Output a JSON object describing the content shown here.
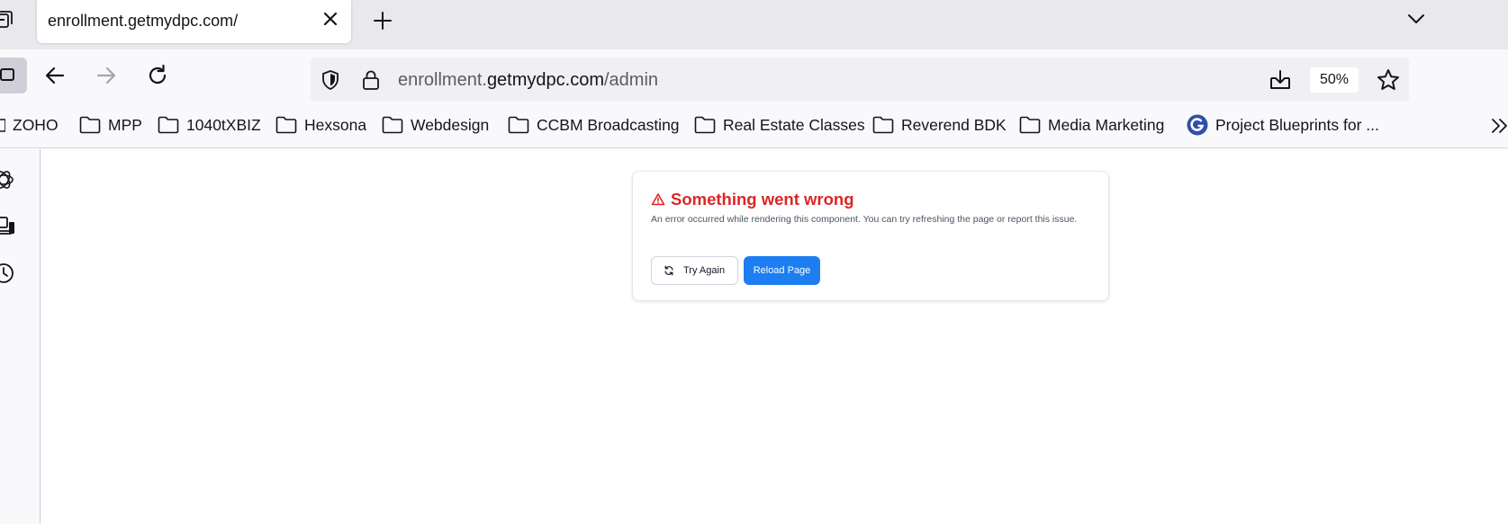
{
  "tab": {
    "title": "enrollment.getmydpc.com/"
  },
  "urlbar": {
    "url_prefix": "enrollment.",
    "url_host": "getmydpc.com",
    "url_path": "/admin",
    "zoom": "50%"
  },
  "bookmarks": [
    {
      "label": "ZOHO",
      "icon": "folder-icon"
    },
    {
      "label": "MPP",
      "icon": "folder-icon"
    },
    {
      "label": "1040tXBIZ",
      "icon": "folder-icon"
    },
    {
      "label": "Hexsona",
      "icon": "folder-icon"
    },
    {
      "label": "Webdesign",
      "icon": "folder-icon"
    },
    {
      "label": "CCBM Broadcasting",
      "icon": "folder-icon"
    },
    {
      "label": "Real Estate Classes",
      "icon": "folder-icon"
    },
    {
      "label": "Reverend BDK",
      "icon": "folder-icon"
    },
    {
      "label": "Media Marketing",
      "icon": "folder-icon"
    },
    {
      "label": "Project Blueprints for ...",
      "icon": "site-g-icon"
    }
  ],
  "error_card": {
    "title": "Something went wrong",
    "description": "An error occurred while rendering this component. You can try refreshing the page or report this issue.",
    "try_again_label": "Try Again",
    "reload_label": "Reload Page"
  },
  "colors": {
    "error_red": "#dc2626",
    "primary_blue": "#1d7ef2"
  }
}
